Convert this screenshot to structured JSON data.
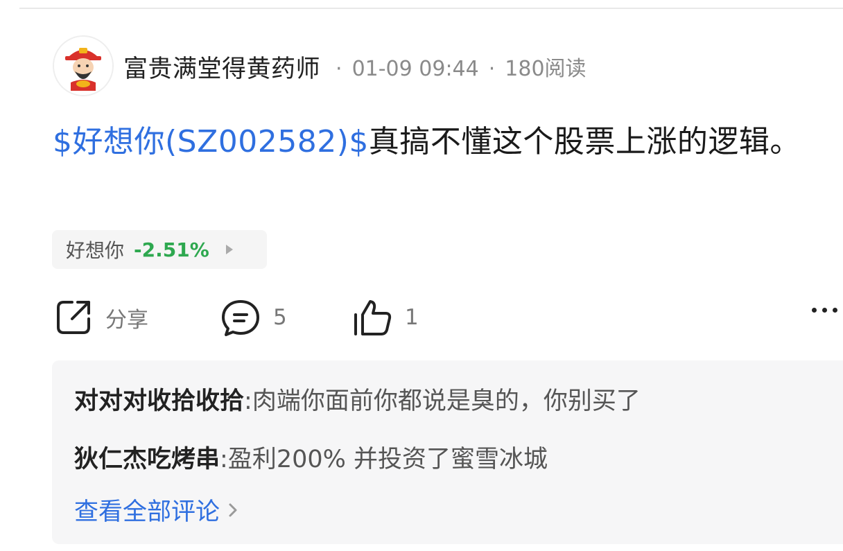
{
  "author": {
    "name": "富贵满堂得黄药师",
    "separator": "·",
    "time": "01-09 09:44",
    "reads": "180阅读"
  },
  "post": {
    "stock_tag": "$好想你(SZ002582)$",
    "text": "真搞不懂这个股票上涨的逻辑。"
  },
  "stock_chip": {
    "name": "好想你",
    "change": "-2.51%",
    "change_color": "#2ea84f"
  },
  "actions": {
    "share_label": "分享",
    "comment_count": "5",
    "like_count": "1"
  },
  "comments": [
    {
      "user": "对对对收拾收拾",
      "sep": ":",
      "text": "肉端你面前你都说是臭的，你别买了"
    },
    {
      "user": "狄仁杰吃烤串",
      "sep": ":",
      "text": "盈利200% 并投资了蜜雪冰城"
    }
  ],
  "view_all_label": "查看全部评论",
  "colors": {
    "link_blue": "#2f6fe0",
    "down_green": "#2ea84f"
  },
  "icons": [
    "avatar-caishen",
    "share-icon",
    "comment-icon",
    "like-icon",
    "more-icon",
    "chevron-right-icon",
    "play-arrow-icon"
  ]
}
